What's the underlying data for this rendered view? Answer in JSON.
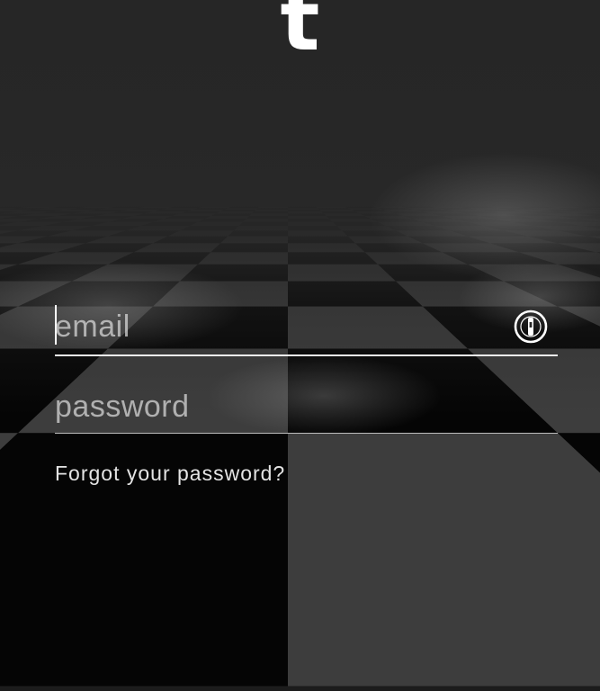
{
  "app": {
    "logo_text": "t"
  },
  "login_form": {
    "email": {
      "placeholder": "email",
      "value": ""
    },
    "password": {
      "placeholder": "password",
      "value": ""
    },
    "password_manager_icon": "password-manager-icon",
    "forgot_password_label": "Forgot your password?"
  },
  "theme": {
    "text_color": "#ffffff",
    "underline_color": "#f2f2f2"
  }
}
